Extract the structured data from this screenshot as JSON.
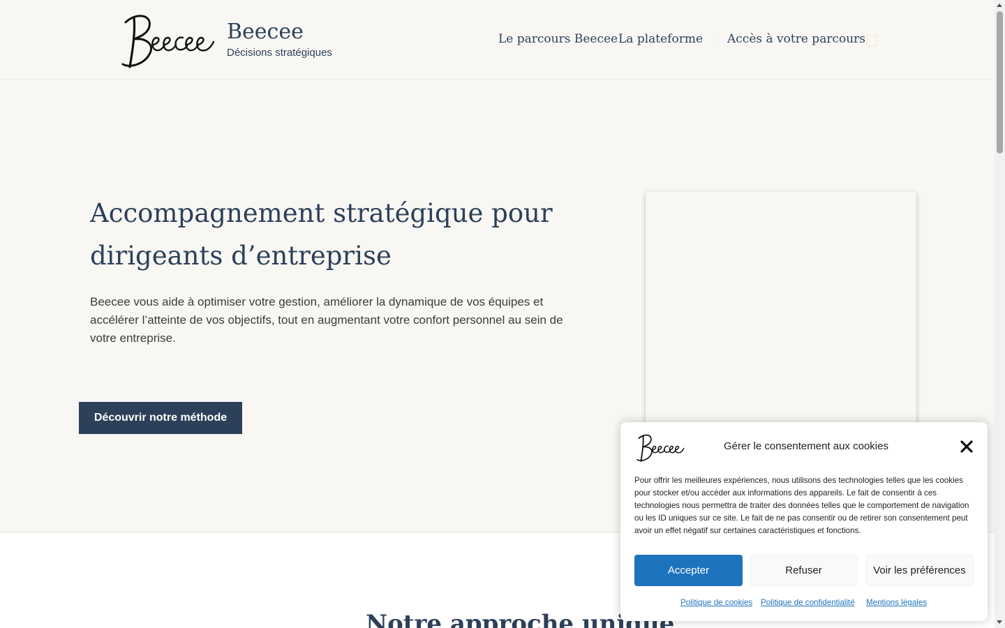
{
  "header": {
    "site_title": "Beecee",
    "site_tagline": "Décisions stratégiques",
    "logo_icon": "beecee-signature-logo",
    "nav": [
      {
        "label": "Le parcours Beecee"
      },
      {
        "label": "La plateforme"
      },
      {
        "label": "Accès à votre parcours",
        "icon": "sparkle-icon"
      }
    ],
    "extra_icon": "outline-square-icon"
  },
  "hero": {
    "title_line1": "Accompagnement stratégique pour",
    "title_line2": "dirigeants d’entreprise",
    "text": "Beecee vous aide à optimiser votre gestion, améliorer la dynamique de vos équipes et accélérer l’atteinte de vos objectifs, tout en augmentant votre confort personnel au sein de votre entreprise.",
    "cta_label": "Découvrir notre méthode"
  },
  "section2": {
    "title": "Notre approche unique"
  },
  "cookie_banner": {
    "title": "Gérer le consentement aux cookies",
    "text": "Pour offrir les meilleures expériences, nous utilisons des technologies telles que les cookies pour stocker et/ou accéder aux informations des appareils. Le fait de consentir à ces technologies nous permettra de traiter des données telles que le comportement de navigation ou les ID uniques sur ce site. Le fait de ne pas consentir ou de retirer son consentement peut avoir un effet négatif sur certaines caractéristiques et fonctions.",
    "accept_label": "Accepter",
    "refuse_label": "Refuser",
    "prefs_label": "Voir les préférences",
    "links": [
      {
        "label": "Politique de cookies"
      },
      {
        "label": "Politique de confidentialité"
      },
      {
        "label": "Mentions légales"
      }
    ]
  },
  "colors": {
    "primary_navy": "#2d4059",
    "accept_blue": "#1e73be",
    "page_bg": "#f8f7f4"
  }
}
